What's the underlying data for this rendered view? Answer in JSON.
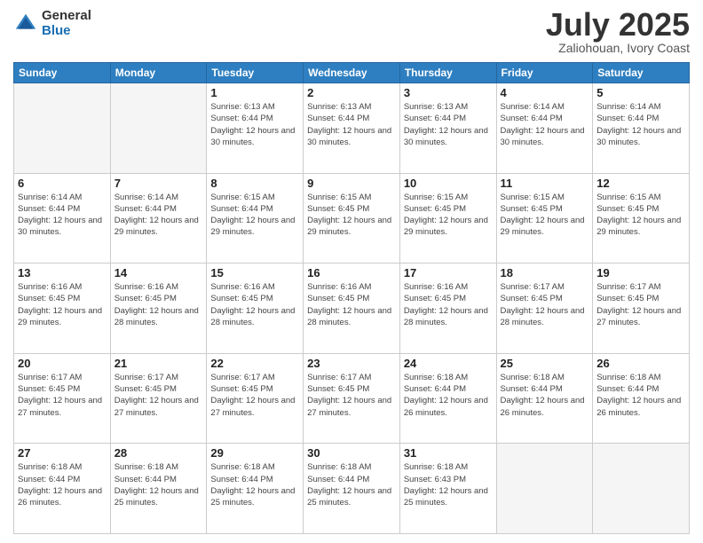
{
  "logo": {
    "general": "General",
    "blue": "Blue"
  },
  "header": {
    "month": "July 2025",
    "location": "Zaliohouan, Ivory Coast"
  },
  "weekdays": [
    "Sunday",
    "Monday",
    "Tuesday",
    "Wednesday",
    "Thursday",
    "Friday",
    "Saturday"
  ],
  "weeks": [
    [
      {
        "day": "",
        "info": ""
      },
      {
        "day": "",
        "info": ""
      },
      {
        "day": "1",
        "info": "Sunrise: 6:13 AM\nSunset: 6:44 PM\nDaylight: 12 hours and 30 minutes."
      },
      {
        "day": "2",
        "info": "Sunrise: 6:13 AM\nSunset: 6:44 PM\nDaylight: 12 hours and 30 minutes."
      },
      {
        "day": "3",
        "info": "Sunrise: 6:13 AM\nSunset: 6:44 PM\nDaylight: 12 hours and 30 minutes."
      },
      {
        "day": "4",
        "info": "Sunrise: 6:14 AM\nSunset: 6:44 PM\nDaylight: 12 hours and 30 minutes."
      },
      {
        "day": "5",
        "info": "Sunrise: 6:14 AM\nSunset: 6:44 PM\nDaylight: 12 hours and 30 minutes."
      }
    ],
    [
      {
        "day": "6",
        "info": "Sunrise: 6:14 AM\nSunset: 6:44 PM\nDaylight: 12 hours and 30 minutes."
      },
      {
        "day": "7",
        "info": "Sunrise: 6:14 AM\nSunset: 6:44 PM\nDaylight: 12 hours and 29 minutes."
      },
      {
        "day": "8",
        "info": "Sunrise: 6:15 AM\nSunset: 6:44 PM\nDaylight: 12 hours and 29 minutes."
      },
      {
        "day": "9",
        "info": "Sunrise: 6:15 AM\nSunset: 6:45 PM\nDaylight: 12 hours and 29 minutes."
      },
      {
        "day": "10",
        "info": "Sunrise: 6:15 AM\nSunset: 6:45 PM\nDaylight: 12 hours and 29 minutes."
      },
      {
        "day": "11",
        "info": "Sunrise: 6:15 AM\nSunset: 6:45 PM\nDaylight: 12 hours and 29 minutes."
      },
      {
        "day": "12",
        "info": "Sunrise: 6:15 AM\nSunset: 6:45 PM\nDaylight: 12 hours and 29 minutes."
      }
    ],
    [
      {
        "day": "13",
        "info": "Sunrise: 6:16 AM\nSunset: 6:45 PM\nDaylight: 12 hours and 29 minutes."
      },
      {
        "day": "14",
        "info": "Sunrise: 6:16 AM\nSunset: 6:45 PM\nDaylight: 12 hours and 28 minutes."
      },
      {
        "day": "15",
        "info": "Sunrise: 6:16 AM\nSunset: 6:45 PM\nDaylight: 12 hours and 28 minutes."
      },
      {
        "day": "16",
        "info": "Sunrise: 6:16 AM\nSunset: 6:45 PM\nDaylight: 12 hours and 28 minutes."
      },
      {
        "day": "17",
        "info": "Sunrise: 6:16 AM\nSunset: 6:45 PM\nDaylight: 12 hours and 28 minutes."
      },
      {
        "day": "18",
        "info": "Sunrise: 6:17 AM\nSunset: 6:45 PM\nDaylight: 12 hours and 28 minutes."
      },
      {
        "day": "19",
        "info": "Sunrise: 6:17 AM\nSunset: 6:45 PM\nDaylight: 12 hours and 27 minutes."
      }
    ],
    [
      {
        "day": "20",
        "info": "Sunrise: 6:17 AM\nSunset: 6:45 PM\nDaylight: 12 hours and 27 minutes."
      },
      {
        "day": "21",
        "info": "Sunrise: 6:17 AM\nSunset: 6:45 PM\nDaylight: 12 hours and 27 minutes."
      },
      {
        "day": "22",
        "info": "Sunrise: 6:17 AM\nSunset: 6:45 PM\nDaylight: 12 hours and 27 minutes."
      },
      {
        "day": "23",
        "info": "Sunrise: 6:17 AM\nSunset: 6:45 PM\nDaylight: 12 hours and 27 minutes."
      },
      {
        "day": "24",
        "info": "Sunrise: 6:18 AM\nSunset: 6:44 PM\nDaylight: 12 hours and 26 minutes."
      },
      {
        "day": "25",
        "info": "Sunrise: 6:18 AM\nSunset: 6:44 PM\nDaylight: 12 hours and 26 minutes."
      },
      {
        "day": "26",
        "info": "Sunrise: 6:18 AM\nSunset: 6:44 PM\nDaylight: 12 hours and 26 minutes."
      }
    ],
    [
      {
        "day": "27",
        "info": "Sunrise: 6:18 AM\nSunset: 6:44 PM\nDaylight: 12 hours and 26 minutes."
      },
      {
        "day": "28",
        "info": "Sunrise: 6:18 AM\nSunset: 6:44 PM\nDaylight: 12 hours and 25 minutes."
      },
      {
        "day": "29",
        "info": "Sunrise: 6:18 AM\nSunset: 6:44 PM\nDaylight: 12 hours and 25 minutes."
      },
      {
        "day": "30",
        "info": "Sunrise: 6:18 AM\nSunset: 6:44 PM\nDaylight: 12 hours and 25 minutes."
      },
      {
        "day": "31",
        "info": "Sunrise: 6:18 AM\nSunset: 6:43 PM\nDaylight: 12 hours and 25 minutes."
      },
      {
        "day": "",
        "info": ""
      },
      {
        "day": "",
        "info": ""
      }
    ]
  ]
}
